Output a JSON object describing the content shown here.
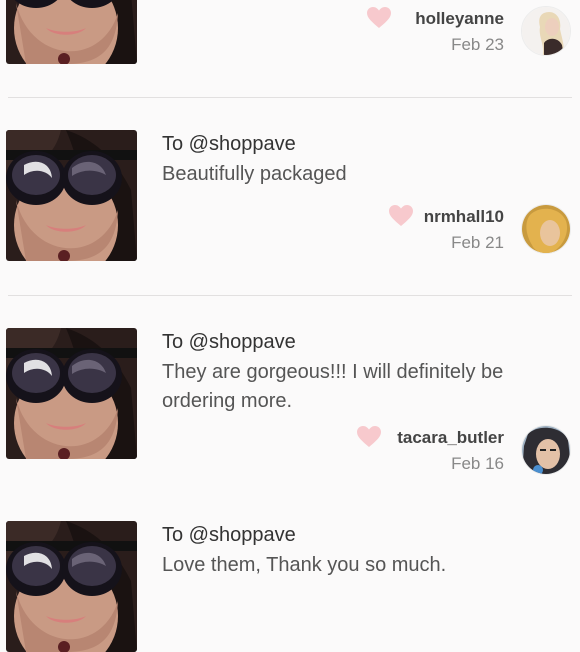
{
  "colors": {
    "heart": "#f7c9cd",
    "text": "#333333",
    "muted": "#888888",
    "divider": "#e2e0e0"
  },
  "reviews": [
    {
      "to": "",
      "message": "",
      "username": "holleyanne",
      "date": "Feb 23"
    },
    {
      "to": "To @shoppave",
      "message": "Beautifully packaged",
      "username": "nrmhall10",
      "date": "Feb 21"
    },
    {
      "to": "To @shoppave",
      "message": "They are gorgeous!!! I will definitely be ordering more.",
      "username": "tacara_butler",
      "date": "Feb 16"
    },
    {
      "to": "To @shoppave",
      "message": "Love them, Thank you so much.",
      "username": "",
      "date": ""
    }
  ],
  "icons": {
    "like": "heart-icon",
    "product": "sunglasses-product-photo"
  }
}
